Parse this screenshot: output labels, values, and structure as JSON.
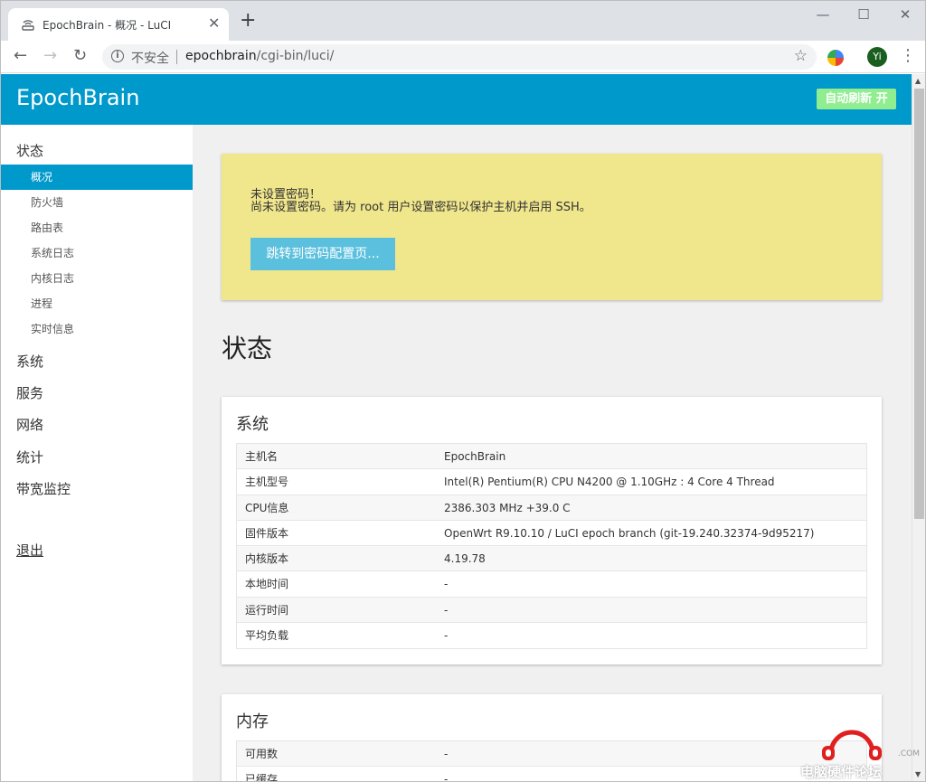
{
  "browser": {
    "tab_title": "EpochBrain - 概况 - LuCI",
    "new_tab": "+",
    "tab_close": "✕",
    "window_controls": {
      "minimize": "—",
      "maximize": "☐",
      "close": "✕"
    },
    "nav": {
      "back": "←",
      "forward": "→",
      "reload": "↻"
    },
    "omnibox": {
      "security_label": "不安全",
      "host": "epochbrain",
      "path": "/cgi-bin/luci/",
      "star": "☆"
    },
    "avatar_initials": "Yi",
    "menu": "⋮"
  },
  "header": {
    "brand": "EpochBrain",
    "autorefresh": "自动刷新 开"
  },
  "sidebar": {
    "status_label": "状态",
    "status_items": [
      {
        "label": "概况",
        "active": true
      },
      {
        "label": "防火墙"
      },
      {
        "label": "路由表"
      },
      {
        "label": "系统日志"
      },
      {
        "label": "内核日志"
      },
      {
        "label": "进程"
      },
      {
        "label": "实时信息"
      }
    ],
    "menus": [
      "系统",
      "服务",
      "网络",
      "统计",
      "带宽监控"
    ],
    "logout": "退出"
  },
  "alert": {
    "title": "未设置密码！",
    "message": "尚未设置密码。请为 root 用户设置密码以保护主机并启用 SSH。",
    "button": "跳转到密码配置页..."
  },
  "page_title": "状态",
  "system": {
    "title": "系统",
    "rows": [
      {
        "key": "主机名",
        "value": "EpochBrain"
      },
      {
        "key": "主机型号",
        "value": "Intel(R) Pentium(R) CPU N4200 @ 1.10GHz : 4 Core 4 Thread"
      },
      {
        "key": "CPU信息",
        "value": "2386.303 MHz +39.0 C"
      },
      {
        "key": "固件版本",
        "value": "OpenWrt R9.10.10 / LuCI epoch branch (git-19.240.32374-9d95217)"
      },
      {
        "key": "内核版本",
        "value": "4.19.78"
      },
      {
        "key": "本地时间",
        "value": "-"
      },
      {
        "key": "运行时间",
        "value": "-"
      },
      {
        "key": "平均负载",
        "value": "-"
      }
    ]
  },
  "memory": {
    "title": "内存",
    "rows": [
      {
        "key": "可用数",
        "value": "-"
      },
      {
        "key": "已缓存",
        "value": "-"
      }
    ]
  },
  "watermark": {
    "text": "电脑硬件论坛",
    "com": ".COM"
  },
  "colors": {
    "header": "#0099cc",
    "alert": "#f0e68c",
    "button": "#5bc0de",
    "autorefresh": "#90ee90"
  }
}
